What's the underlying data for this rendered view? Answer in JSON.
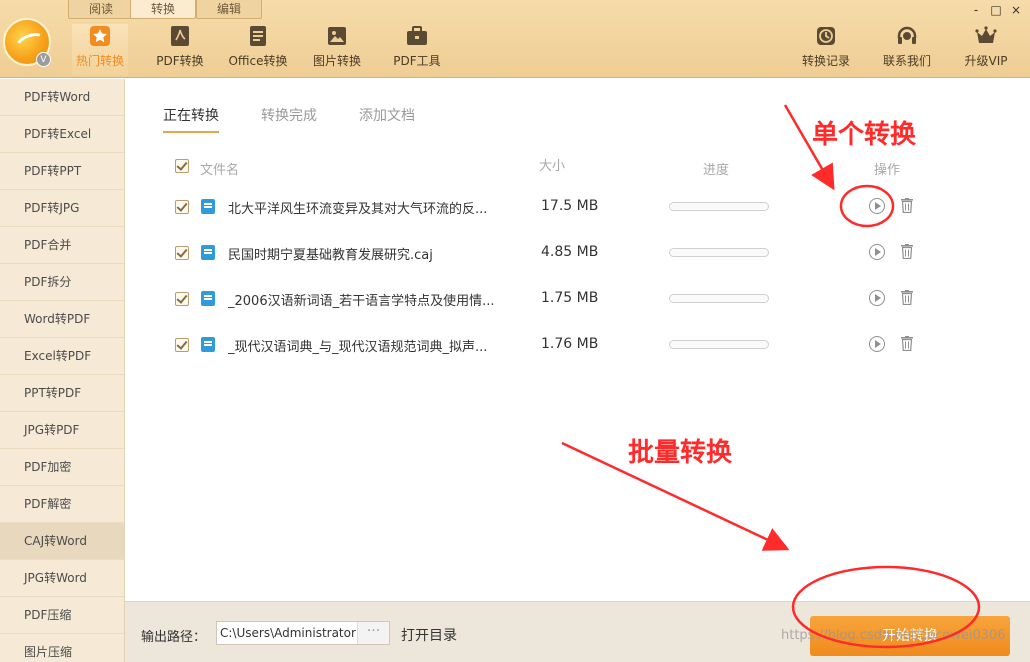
{
  "top_tabs": [
    "阅读",
    "转换",
    "编辑"
  ],
  "window_controls": [
    "-",
    "□",
    "×"
  ],
  "nav_left": [
    {
      "label": "热门转换",
      "icon": "star-icon",
      "active": true
    },
    {
      "label": "PDF转换",
      "icon": "pdf-icon"
    },
    {
      "label": "Office转换",
      "icon": "document-icon"
    },
    {
      "label": "图片转换",
      "icon": "image-icon"
    },
    {
      "label": "PDF工具",
      "icon": "toolbox-icon"
    }
  ],
  "nav_right": [
    {
      "label": "转换记录",
      "icon": "clock-icon"
    },
    {
      "label": "联系我们",
      "icon": "headset-icon"
    },
    {
      "label": "升级VIP",
      "icon": "crown-icon"
    }
  ],
  "sidebar": {
    "items": [
      "PDF转Word",
      "PDF转Excel",
      "PDF转PPT",
      "PDF转JPG",
      "PDF合并",
      "PDF拆分",
      "Word转PDF",
      "Excel转PDF",
      "PPT转PDF",
      "JPG转PDF",
      "PDF加密",
      "PDF解密",
      "CAJ转Word",
      "JPG转Word",
      "PDF压缩",
      "图片压缩"
    ],
    "active": "CAJ转Word"
  },
  "sub_tabs": [
    "正在转换",
    "转换完成",
    "添加文档"
  ],
  "table": {
    "headers": {
      "name": "文件名",
      "size": "大小",
      "progress": "进度",
      "action": "操作"
    },
    "rows": [
      {
        "name": "北大平洋风生环流变异及其对大气环流的反...",
        "size": "17.5 MB",
        "progress": 0
      },
      {
        "name": "民国时期宁夏基础教育发展研究.caj",
        "size": "4.85 MB",
        "progress": 0
      },
      {
        "name": "_2006汉语新词语_若干语言学特点及使用情...",
        "size": "1.75 MB",
        "progress": 0
      },
      {
        "name": "_现代汉语词典_与_现代汉语规范词典_拟声...",
        "size": "1.76 MB",
        "progress": 0
      }
    ]
  },
  "bottom": {
    "output_label": "输出路径：",
    "path": "C:\\Users\\Administrator",
    "dots": "···",
    "open_dir": "打开目录",
    "start": "开始转换",
    "watermark": "https://blog.csdn.net/cocowei0306"
  },
  "annotations": {
    "single": "单个转换",
    "batch": "批量转换",
    "color": "#ff2a2a"
  },
  "colors": {
    "accent": "#f28c1c",
    "header_bg": "#efcd94",
    "sidebar_bg": "#f6ead6"
  }
}
